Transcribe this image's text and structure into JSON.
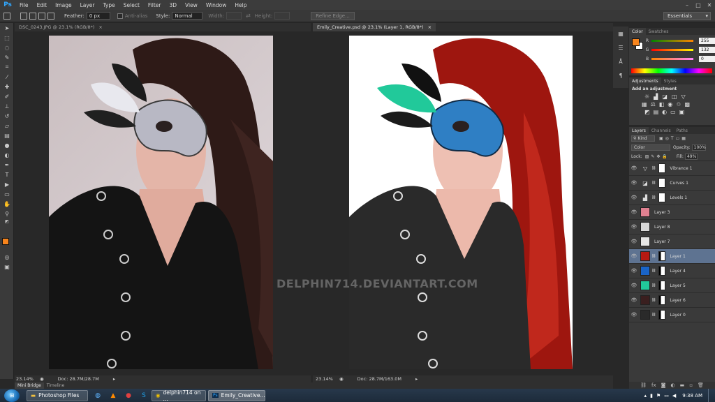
{
  "app": {
    "logo": "Ps",
    "menu": [
      "File",
      "Edit",
      "Image",
      "Layer",
      "Type",
      "Select",
      "Filter",
      "3D",
      "View",
      "Window",
      "Help"
    ]
  },
  "options": {
    "feather_label": "Feather:",
    "feather_value": "0 px",
    "antialias_label": "Anti-alias",
    "style_label": "Style:",
    "style_value": "Normal",
    "width_label": "Width:",
    "height_label": "Height:",
    "refine_edge": "Refine Edge...",
    "workspace": "Essentials"
  },
  "documents": [
    {
      "tab": "DSC_0243.JPG @ 23.1% (RGB/8*)",
      "zoom": "23.14%",
      "doc_size": "Doc: 28.7M/28.7M"
    },
    {
      "tab": "Emily_Creative.psd @ 23.1% (Layer 1, RGB/8*)",
      "zoom": "23.14%",
      "doc_size": "Doc: 28.7M/163.0M",
      "watermark": "DELPHIN714.DEVIANTART.COM"
    }
  ],
  "bottom_tabs": [
    "Mini Bridge",
    "Timeline"
  ],
  "color_panel": {
    "tabs": [
      "Color",
      "Swatches"
    ],
    "r_label": "R",
    "g_label": "G",
    "b_label": "B",
    "r_value": "255",
    "g_value": "132",
    "b_value": "0",
    "foreground": "#f7841c"
  },
  "adjustments_panel": {
    "tabs": [
      "Adjustments",
      "Styles"
    ],
    "heading": "Add an adjustment"
  },
  "layers_panel": {
    "tabs": [
      "Layers",
      "Channels",
      "Paths"
    ],
    "filter_kind": "Kind",
    "blend_mode": "Color",
    "opacity_label": "Opacity:",
    "opacity_value": "100%",
    "lock_label": "Lock:",
    "fill_label": "Fill:",
    "fill_value": "49%",
    "layers": [
      {
        "name": "Vibrance 1",
        "type": "adjustment",
        "icon": "vibrance-icon",
        "selected": false
      },
      {
        "name": "Curves 1",
        "type": "adjustment",
        "icon": "curves-icon",
        "selected": false
      },
      {
        "name": "Levels 1",
        "type": "adjustment",
        "icon": "levels-icon",
        "selected": false
      },
      {
        "name": "Layer 3",
        "type": "pixel",
        "thumb": "#e08090",
        "selected": false
      },
      {
        "name": "Layer 8",
        "type": "pixel",
        "thumb": "#d8d8d8",
        "selected": false
      },
      {
        "name": "Layer 7",
        "type": "pixel",
        "thumb": "#e6e6e6",
        "selected": false
      },
      {
        "name": "Layer 1",
        "type": "masked",
        "thumb": "#b51a12",
        "selected": true
      },
      {
        "name": "Layer 4",
        "type": "masked",
        "thumb": "#1a64c8",
        "selected": false
      },
      {
        "name": "Layer 5",
        "type": "masked",
        "thumb": "#21c99a",
        "selected": false
      },
      {
        "name": "Layer 6",
        "type": "masked",
        "thumb": "#3a1f1f",
        "selected": false
      },
      {
        "name": "Layer 0",
        "type": "masked",
        "thumb": "#2a2a2a",
        "selected": false
      }
    ]
  },
  "taskbar": {
    "buttons": [
      "Photoshop Files",
      "delphin714 on ...",
      "Emily_Creative..."
    ],
    "time": "9:38 AM"
  }
}
